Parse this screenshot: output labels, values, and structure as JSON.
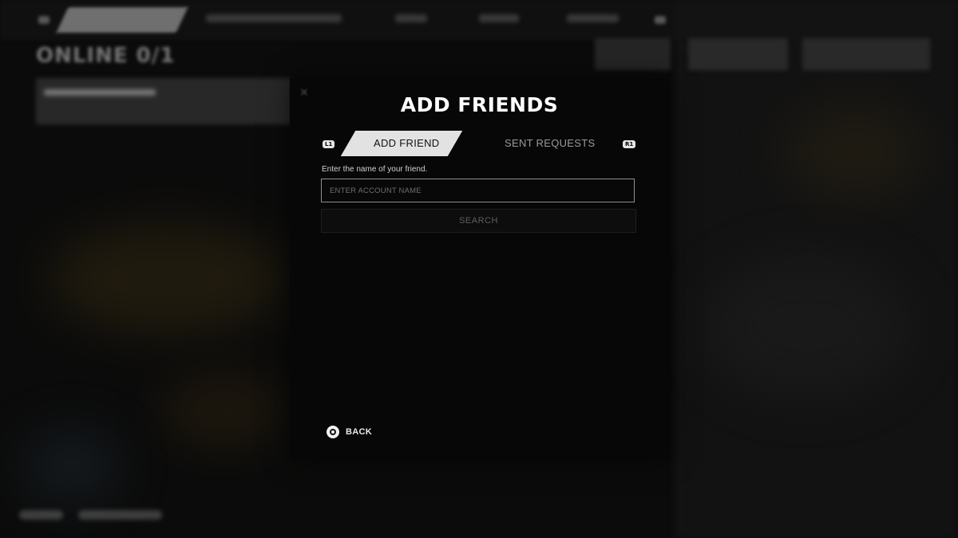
{
  "background": {
    "online_status": "ONLINE 0/1"
  },
  "modal": {
    "title": "ADD FRIENDS",
    "tabs": [
      {
        "label": "ADD FRIEND",
        "active": true
      },
      {
        "label": "SENT REQUESTS",
        "active": false
      }
    ],
    "left_bumper": "L1",
    "right_bumper": "R1",
    "instruction": "Enter the name of your friend.",
    "input": {
      "value": "",
      "placeholder": "ENTER ACCOUNT NAME"
    },
    "search_label": "SEARCH",
    "back_label": "BACK"
  },
  "colors": {
    "modal_background": "#070707",
    "active_tab": "#e2e2e2",
    "input_border": "#8f8f8f"
  },
  "icons": {
    "back": "circle-button-icon"
  }
}
